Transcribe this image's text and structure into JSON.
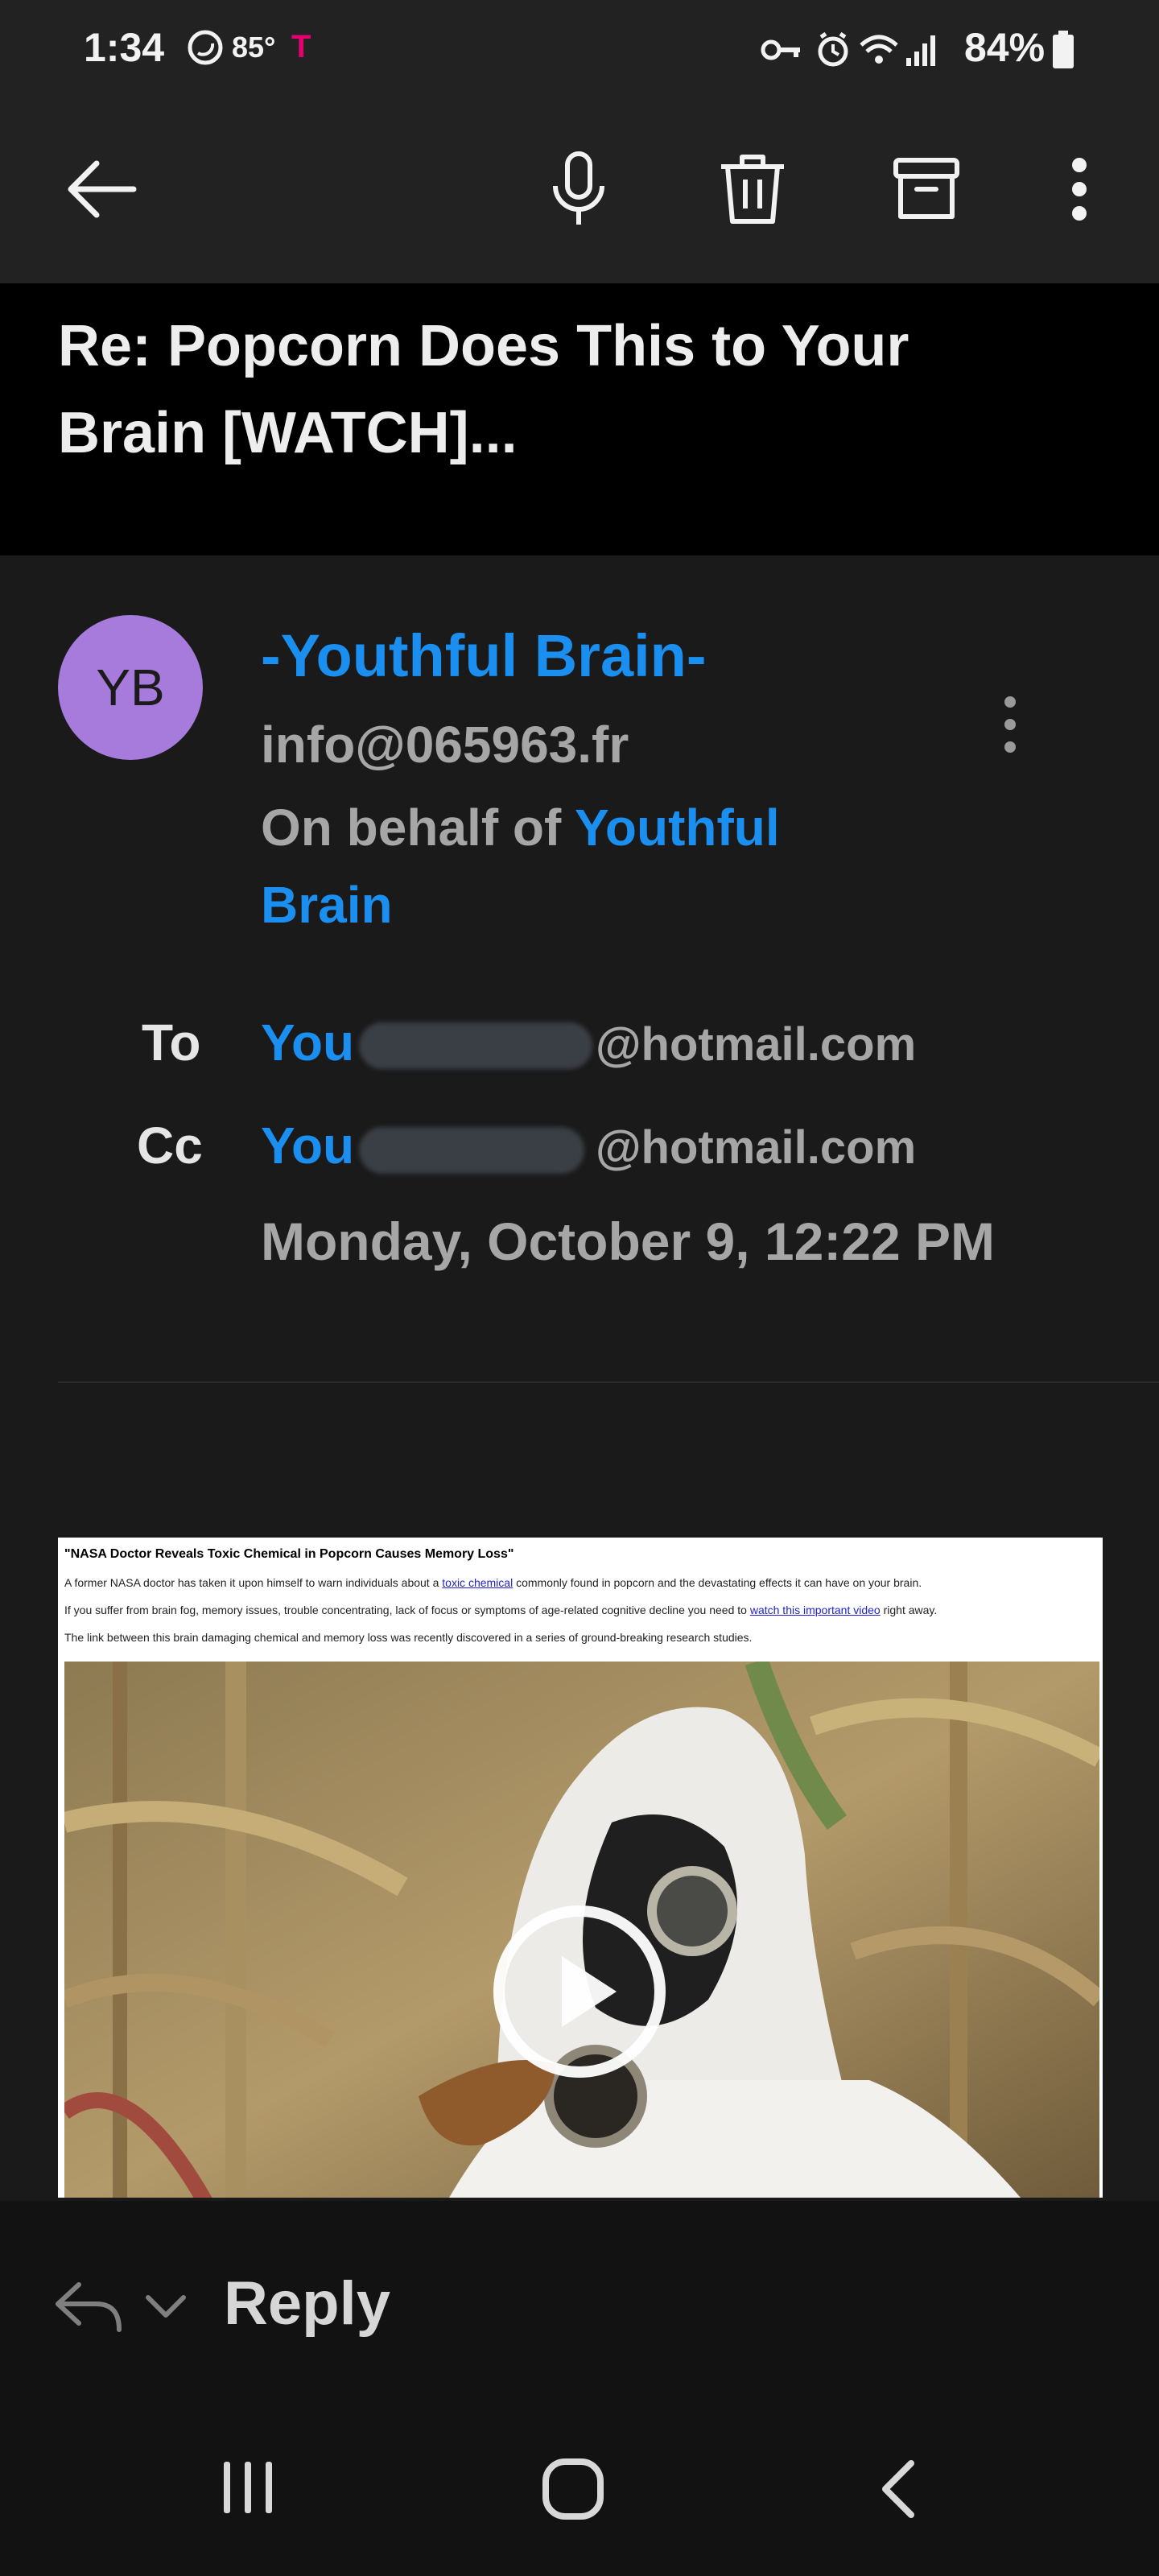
{
  "status_bar": {
    "time": "1:34",
    "temperature": "85°",
    "carrier_icon": "T",
    "battery_percent": "84%",
    "icons": [
      "sync-icon",
      "key-icon",
      "alarm-icon",
      "wifi-icon",
      "signal-icon",
      "battery-icon"
    ]
  },
  "app_bar": {
    "icons": [
      "back-arrow-icon",
      "microphone-icon",
      "delete-icon",
      "archive-icon",
      "more-vertical-icon"
    ]
  },
  "email": {
    "subject": "Re: Popcorn Does This to Your Brain [WATCH]...",
    "avatar_initials": "YB",
    "avatar_color": "#a77bdb",
    "sender_name": "-Youthful Brain-",
    "sender_email": "info@065963.fr",
    "on_behalf_prefix": "On behalf of",
    "on_behalf_name": "Youthful Brain",
    "to_label": "To",
    "to_name": "You",
    "to_domain": "@hotmail.com",
    "cc_label": "Cc",
    "cc_name": "You",
    "cc_domain": "@hotmail.com",
    "date": "Monday, October 9, 12:22 PM"
  },
  "content": {
    "headline": "\"NASA Doctor Reveals Toxic Chemical in Popcorn Causes Memory Loss\"",
    "p1_before": "A former NASA doctor has taken it upon himself to warn individuals about a",
    "p1_link": "toxic chemical",
    "p1_after": "commonly found in popcorn and the devastating effects it can have on your brain.",
    "p2_before": "If you suffer from brain fog, memory issues, trouble concentrating, lack of focus or symptoms of age-related cognitive decline you need to",
    "p2_link": "watch this important video",
    "p2_after": "right away.",
    "p3": "The link between this brain damaging chemical and memory loss was recently discovered in a series of ground-breaking research studies.",
    "video_icon": "play-icon"
  },
  "reply_bar": {
    "reply_label": "Reply",
    "icons": [
      "reply-icon",
      "chevron-down-icon"
    ]
  },
  "nav_bar": {
    "icons": [
      "recent-apps-icon",
      "home-icon",
      "nav-back-icon"
    ]
  },
  "colors": {
    "accent_blue": "#1a8ff0",
    "background": "#1a1a1a",
    "bar_background": "#222222"
  }
}
